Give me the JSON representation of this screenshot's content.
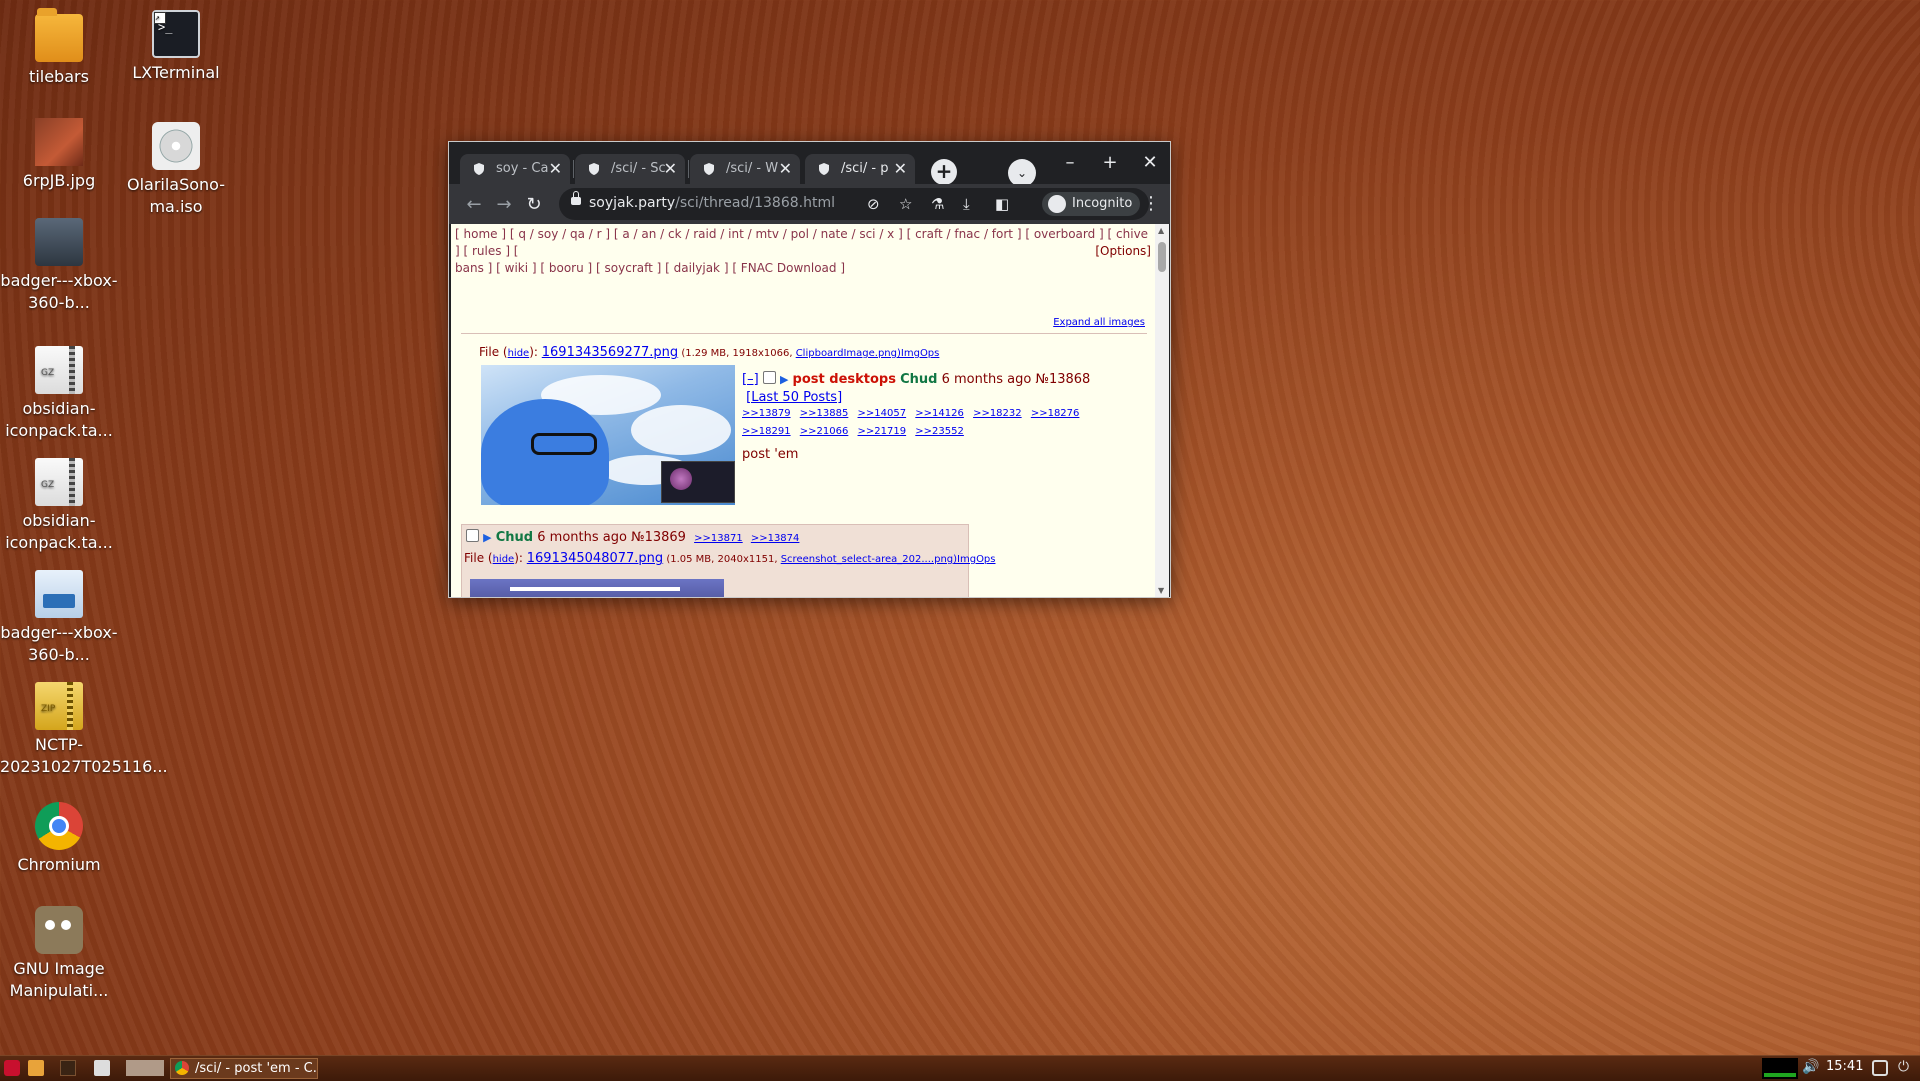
{
  "desktop": {
    "icons": [
      {
        "label": "tilebars"
      },
      {
        "label": "LXTerminal"
      },
      {
        "label": "6rpJB.jpg"
      },
      {
        "label": "OlarilaSono-ma.iso"
      },
      {
        "label": "badger---xbox-360-b..."
      },
      {
        "label": "obsidian-iconpack.ta..."
      },
      {
        "label": "obsidian-iconpack.ta..."
      },
      {
        "label": "badger---xbox-360-b..."
      },
      {
        "label": "NCTP-20231027T025116..."
      },
      {
        "label": "Chromium"
      },
      {
        "label": "GNU Image Manipulati..."
      }
    ],
    "archive_gz": "GZ",
    "archive_zip": "ZIP",
    "terminal_prompt": ">_"
  },
  "browser": {
    "tabs": [
      {
        "title": "soy - Ca"
      },
      {
        "title": "/sci/ - Sc"
      },
      {
        "title": "/sci/ - W"
      },
      {
        "title": "/sci/ - p"
      }
    ],
    "tab_close": "✕",
    "new_tab": "+",
    "tab_search": "⌄",
    "window_controls": {
      "minimize": "–",
      "maximize": "+",
      "close": "✕"
    },
    "nav": {
      "back": "←",
      "forward": "→",
      "reload": "↻",
      "menu": "⋮"
    },
    "url_host": "soyjak.party",
    "url_path": "/sci/thread/13868.html",
    "incognito_label": "Incognito"
  },
  "page": {
    "boardlist_line1": "[ home ] [ q / soy / qa / r ] [ a / an / ck / raid / int / mtv / pol / nate / sci / x ] [ craft / fnac / fort ] [ overboard ] [ chive ] [ rules ] [",
    "boardlist_line2": "bans ] [ wiki ] [ booru ] [ soycraft ] [ dailyjak ] [ FNAC Download ]",
    "options": "[Options]",
    "expand_all": "Expand all images",
    "op": {
      "file_prefix": "File (",
      "hide": "hide",
      "file_mid": "): ",
      "filename": "1691343569277.png",
      "file_meta": " (1.29 MB, 1918x1066, ",
      "orig_name": "ClipboardImage.png",
      "imgops": ")ImgOps",
      "toggle": "[–]",
      "arrow": "▶",
      "subject": "post desktops",
      "name": "Chud",
      "time": "6 months ago",
      "no": "№13868",
      "last50": "[Last 50 Posts]",
      "replies": [
        ">>13879",
        ">>13885",
        ">>14057",
        ">>14126",
        ">>18232",
        ">>18276",
        ">>18291",
        ">>21066",
        ">>21719",
        ">>23552"
      ],
      "body": "post 'em"
    },
    "reply": {
      "arrow": "▶",
      "name": "Chud",
      "time": "6 months ago",
      "no": "№13869",
      "backlinks": [
        ">>13871",
        ">>13874"
      ],
      "file_prefix": "File (",
      "hide": "hide",
      "file_mid": "): ",
      "filename": "1691345048077.png",
      "file_meta": " (1.05 MB, 2040x1151, ",
      "orig_name": "Screenshot_select-area_202....png",
      "imgops": ")ImgOps"
    }
  },
  "taskbar": {
    "active_window": "/sci/ - post 'em - C...",
    "clock": "15:41",
    "volume_icon": "🔊",
    "power_icon": "⏻"
  }
}
